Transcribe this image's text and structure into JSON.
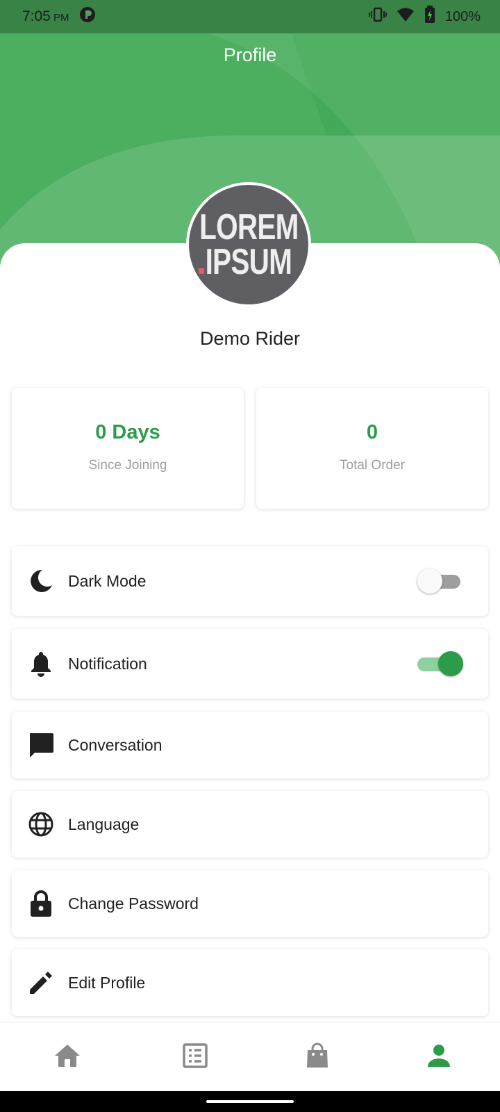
{
  "status_bar": {
    "time": "7:05",
    "ampm": "PM",
    "battery": "100%"
  },
  "header": {
    "title": "Profile"
  },
  "profile": {
    "avatar_text_line1": "LOREM",
    "avatar_text_line2": "IPSUM",
    "name": "Demo Rider"
  },
  "stats": [
    {
      "value": "0 Days",
      "label": "Since Joining"
    },
    {
      "value": "0",
      "label": "Total Order"
    }
  ],
  "menu": [
    {
      "label": "Dark Mode",
      "icon": "moon-icon",
      "toggle": false
    },
    {
      "label": "Notification",
      "icon": "bell-icon",
      "toggle": true
    },
    {
      "label": "Conversation",
      "icon": "chat-icon"
    },
    {
      "label": "Language",
      "icon": "globe-icon"
    },
    {
      "label": "Change Password",
      "icon": "lock-icon"
    },
    {
      "label": "Edit Profile",
      "icon": "pencil-icon"
    }
  ],
  "bottom_nav": [
    {
      "name": "home",
      "icon": "home-icon",
      "active": false
    },
    {
      "name": "orders",
      "icon": "list-icon",
      "active": false
    },
    {
      "name": "shop",
      "icon": "shopping-bag-icon",
      "active": false
    },
    {
      "name": "profile",
      "icon": "person-icon",
      "active": true
    }
  ],
  "colors": {
    "primary": "#2e9b4b",
    "header": "#4caf5f",
    "toggle_off_track": "#9e9e9e",
    "toggle_on_track": "#8fd0a0",
    "inactive_icon": "#8a8a8a"
  }
}
